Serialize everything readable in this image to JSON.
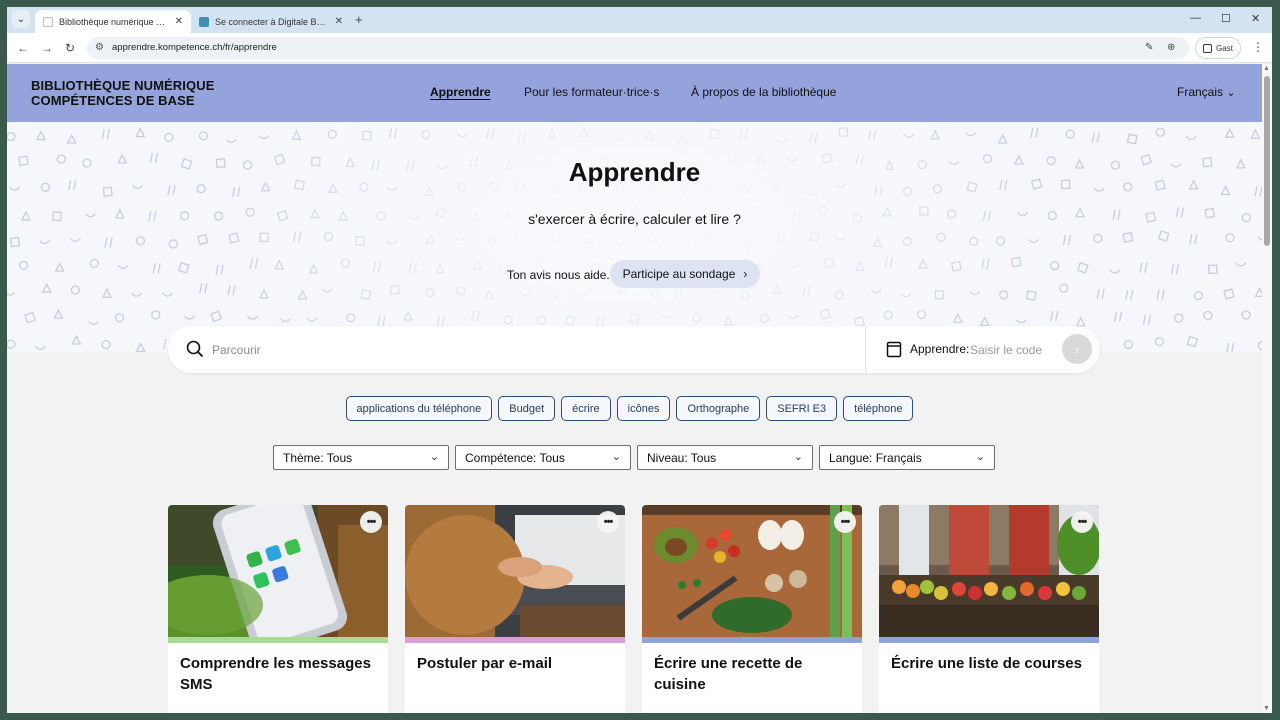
{
  "browser": {
    "tabs": [
      {
        "title": "Bibliothèque numérique - Appr",
        "active": true
      },
      {
        "title": "Se connecter à Digitale Biblioth",
        "active": false
      }
    ],
    "url": "apprendre.kompetence.ch/fr/apprendre",
    "profile_label": "Gast"
  },
  "header": {
    "logo_line1": "BIBLIOTHÈQUE NUMÉRIQUE",
    "logo_line2": "COMPÉTENCES DE BASE",
    "nav": [
      {
        "label": "Apprendre",
        "active": true
      },
      {
        "label": "Pour les formateur·trice·s",
        "active": false
      },
      {
        "label": "À propos de la bibliothèque",
        "active": false
      }
    ],
    "language": "Français"
  },
  "hero": {
    "title": "Apprendre",
    "subtitle": "s'exercer à écrire, calculer et lire ?",
    "survey_text": "Ton avis nous aide.",
    "survey_button": "Participe au sondage"
  },
  "search": {
    "placeholder": "Parcourir",
    "code_label": "Apprendre:",
    "code_placeholder": "Saisir le code"
  },
  "tags": [
    "applications du téléphone",
    "Budget",
    "écrire",
    "icônes",
    "Orthographe",
    "SEFRI E3",
    "téléphone"
  ],
  "filters": [
    "Thème: Tous",
    "Compétence: Tous",
    "Niveau: Tous",
    "Langue: Français"
  ],
  "cards": [
    {
      "title": "Comprendre les messages SMS",
      "stripe_color": "#a6dc94"
    },
    {
      "title": "Postuler par e-mail",
      "stripe_color": "#dc9ed8"
    },
    {
      "title": "Écrire une recette de cuisine",
      "stripe_color": "#8ea3dc"
    },
    {
      "title": "Écrire une liste de courses",
      "stripe_color": "#8ea3dc"
    }
  ],
  "colors": {
    "header_bg": "#94a3db",
    "tag_border": "#2f4d75",
    "survey_bg": "#dde3f3"
  }
}
